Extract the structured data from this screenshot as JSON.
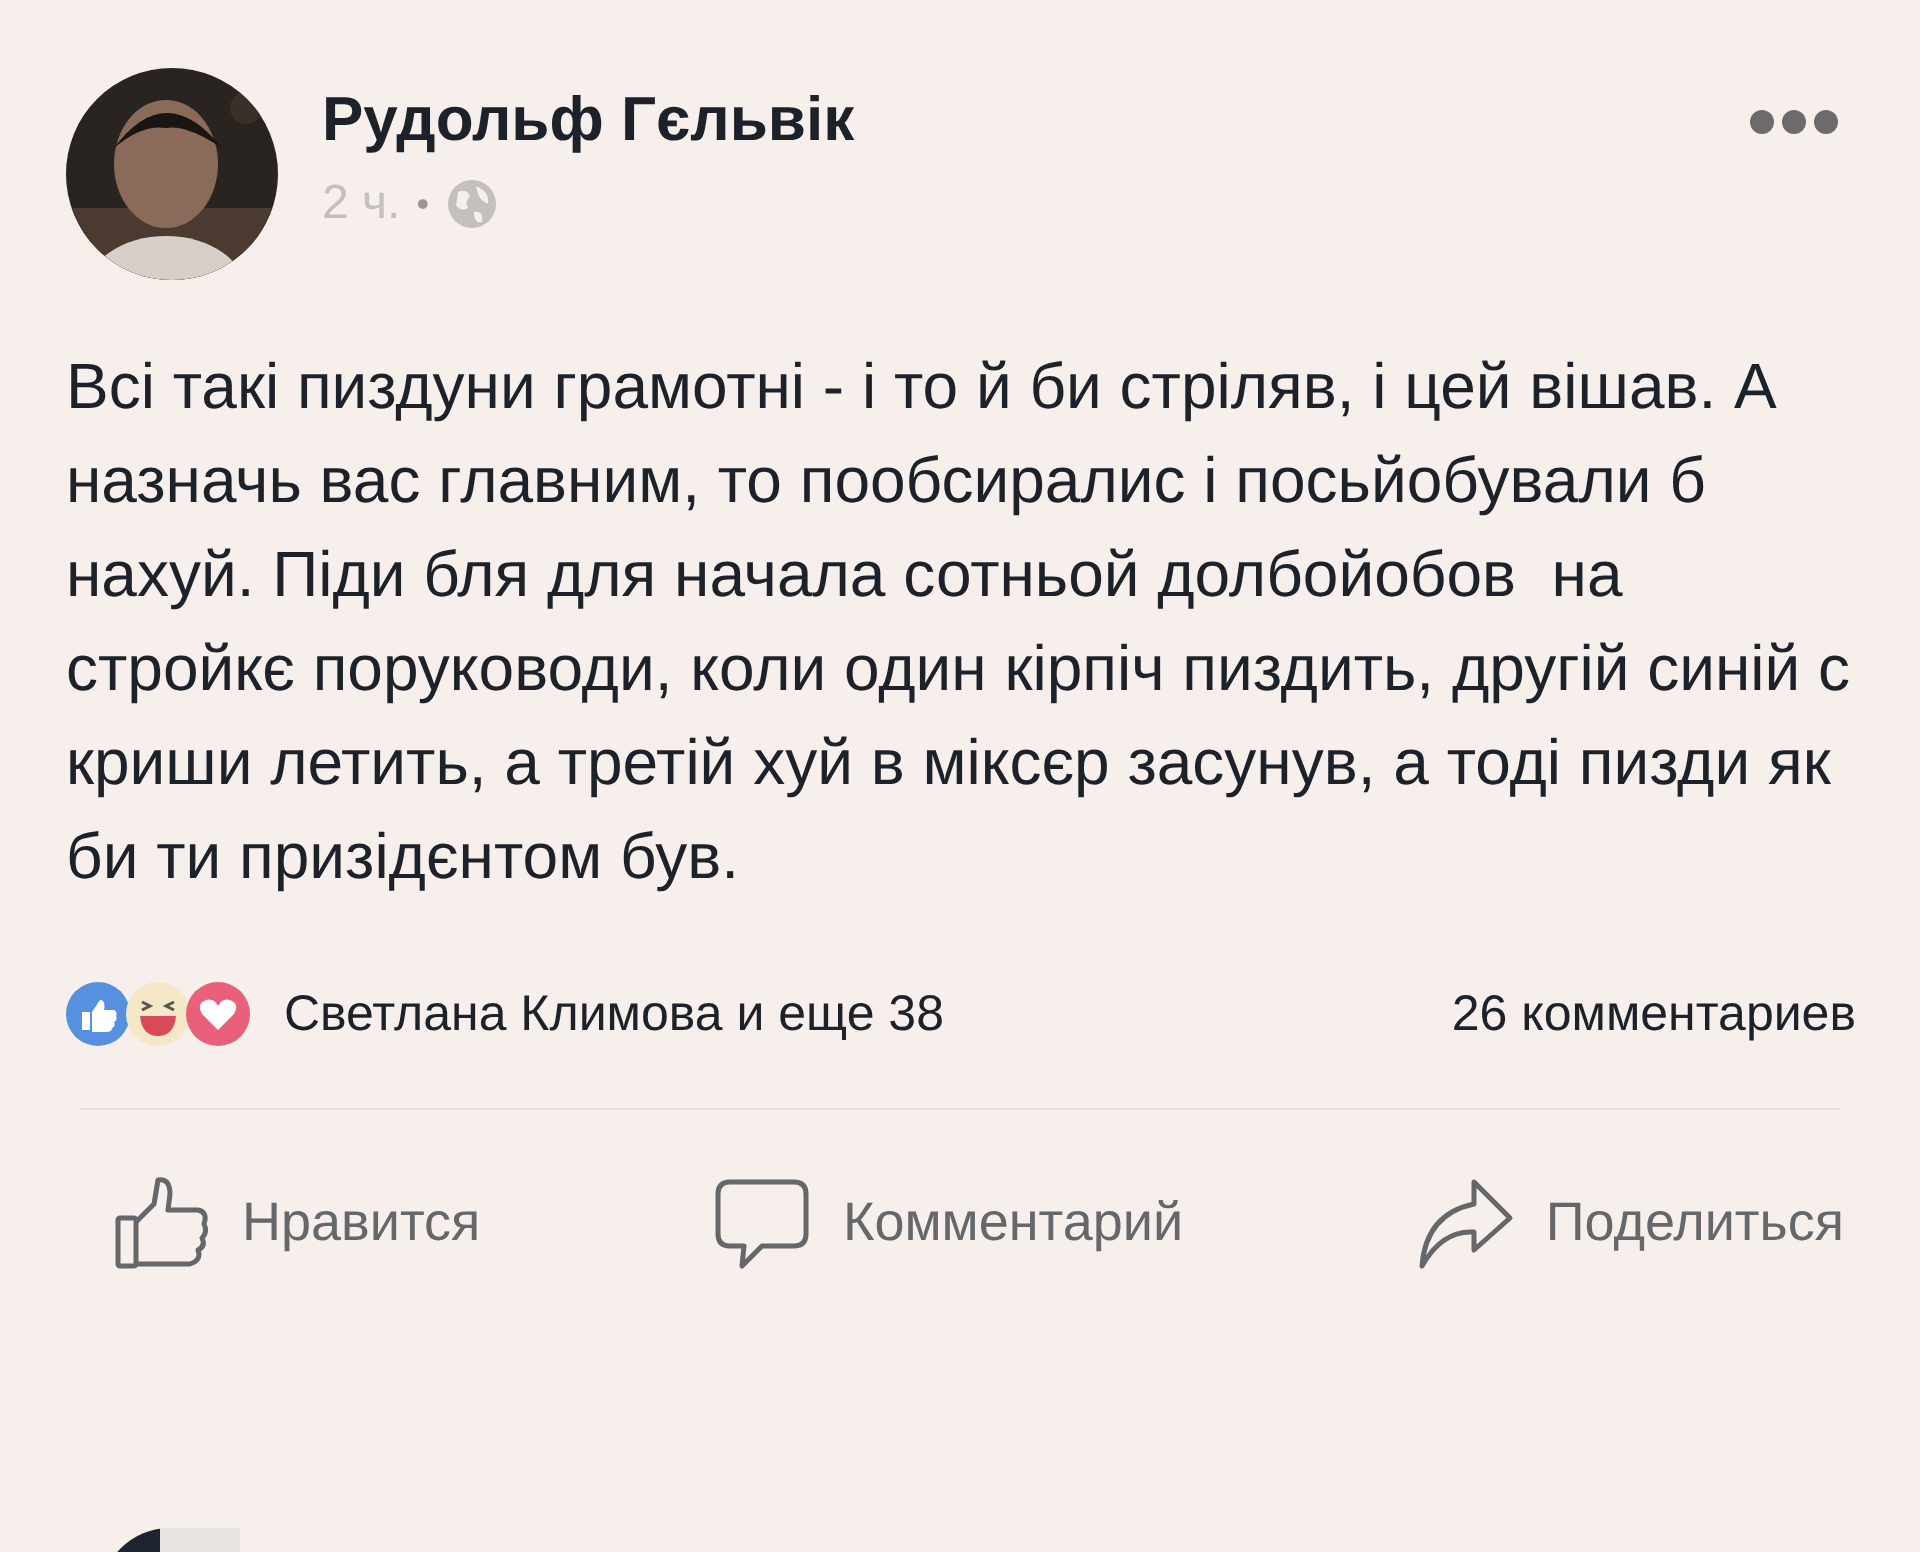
{
  "post": {
    "author": "Рудольф Гєльвік",
    "time": "2 ч.",
    "separator": "•",
    "text": "Всі такі пиздуни грамотні - і то й би стріляв, і цей вішав. А назначь вас главним, то пообсиралис і посьйобували б нахуй. Піди бля для начала сотньой долбойобов  на стройкє поруководи, коли один кірпіч пиздить, другій синій с криши летить, а третій хуй в міксєр засунув, а тоді пизди як би ти призідєнтом був.",
    "reactions_summary": "Светлана Климова и еще 38",
    "comments_count": "26 комментариев",
    "actions": [
      {
        "kind": "like",
        "label": "Нравится"
      },
      {
        "kind": "comment",
        "label": "Комментарий"
      },
      {
        "kind": "share",
        "label": "Поделиться"
      }
    ]
  }
}
